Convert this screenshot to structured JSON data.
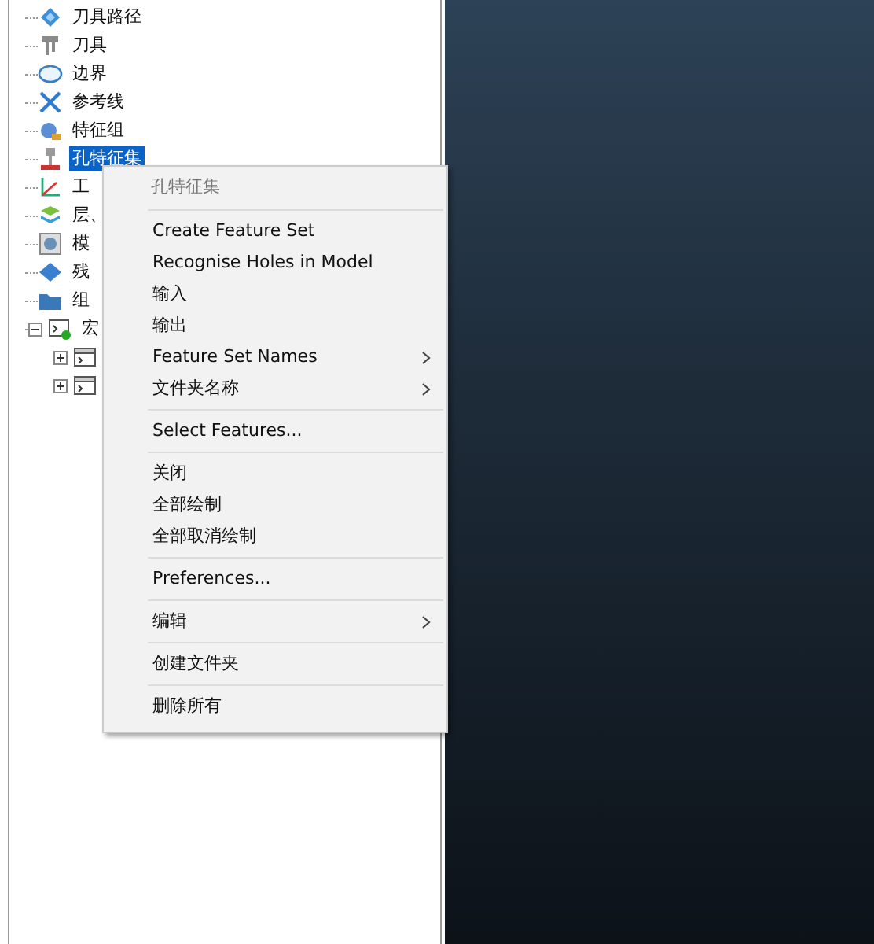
{
  "tree": {
    "items": [
      {
        "label": "刀具路径",
        "selected": false
      },
      {
        "label": "刀具",
        "selected": false
      },
      {
        "label": "边界",
        "selected": false
      },
      {
        "label": "参考线",
        "selected": false
      },
      {
        "label": "特征组",
        "selected": false
      },
      {
        "label": "孔特征集",
        "selected": true
      },
      {
        "label": "工",
        "selected": false
      },
      {
        "label": "层、",
        "selected": false
      },
      {
        "label": "模",
        "selected": false
      },
      {
        "label": "残",
        "selected": false
      },
      {
        "label": "组",
        "selected": false
      },
      {
        "label": "宏",
        "selected": false,
        "expanded": true,
        "children": [
          {
            "expanded": false
          },
          {
            "expanded": false
          }
        ]
      }
    ]
  },
  "context_menu": {
    "title": "孔特征集",
    "groups": [
      [
        {
          "label": "Create Feature Set",
          "submenu": false
        },
        {
          "label": "Recognise Holes in Model",
          "submenu": false
        },
        {
          "label": "输入",
          "submenu": false
        },
        {
          "label": "输出",
          "submenu": false
        },
        {
          "label": "Feature Set Names",
          "submenu": true
        },
        {
          "label": "文件夹名称",
          "submenu": true
        }
      ],
      [
        {
          "label": "Select Features...",
          "submenu": false
        }
      ],
      [
        {
          "label": "关闭",
          "submenu": false
        },
        {
          "label": "全部绘制",
          "submenu": false
        },
        {
          "label": "全部取消绘制",
          "submenu": false
        }
      ],
      [
        {
          "label": "Preferences...",
          "submenu": false
        }
      ],
      [
        {
          "label": "编辑",
          "submenu": true
        }
      ],
      [
        {
          "label": "创建文件夹",
          "submenu": false
        }
      ],
      [
        {
          "label": "删除所有",
          "submenu": false
        }
      ]
    ]
  }
}
